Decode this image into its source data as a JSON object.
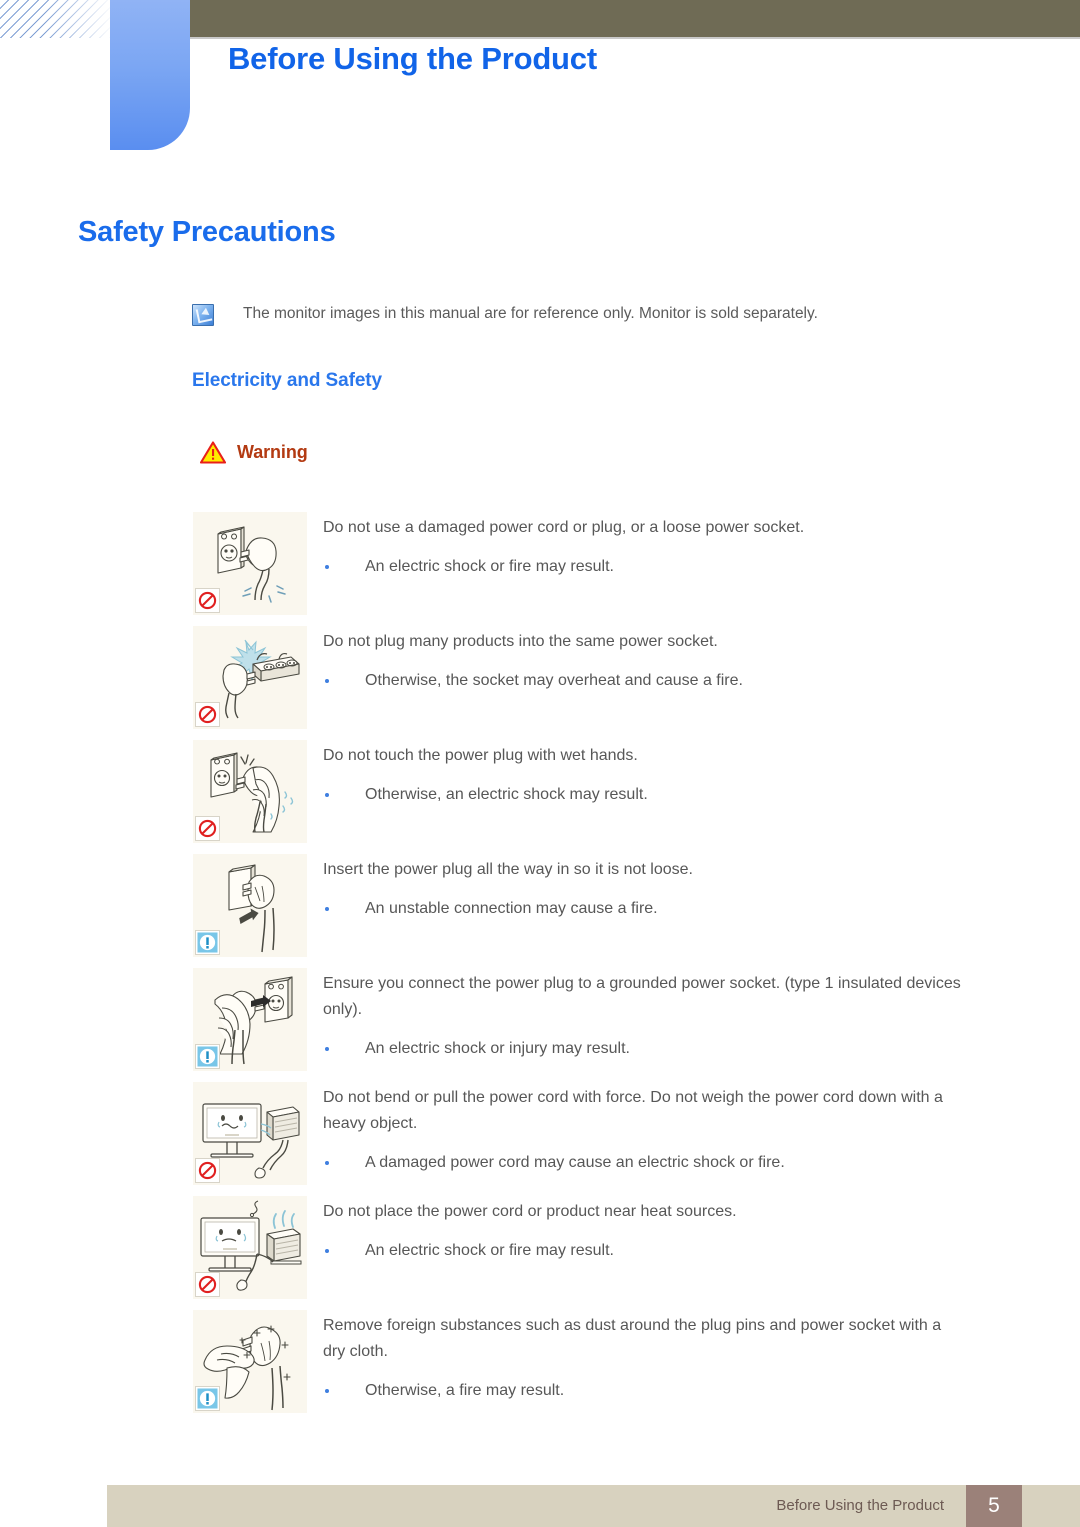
{
  "header": {
    "chapter_title": "Before Using the Product",
    "bar_color": "#6f6b55",
    "tab_color": "#7ba6f3",
    "title_color": "#1164e8"
  },
  "page_title": "Safety Precautions",
  "note": {
    "icon": "note-pen-icon",
    "text": "The monitor images in this manual are for reference only. Monitor is sold separately."
  },
  "section": {
    "heading": "Electricity and Safety",
    "warning_icon": "warning-triangle-icon",
    "warning_label": "Warning"
  },
  "items": [
    {
      "figure": "damaged-plug-socket-illustration",
      "badge": "prohibition-icon",
      "lead": "Do not use a damaged power cord or plug, or a loose power socket.",
      "bullets": [
        "An electric shock or fire may result."
      ]
    },
    {
      "figure": "overloaded-power-strip-illustration",
      "badge": "prohibition-icon",
      "lead": "Do not plug many products into the same power socket.",
      "bullets": [
        "Otherwise, the socket may overheat and cause a fire."
      ]
    },
    {
      "figure": "wet-hands-plug-illustration",
      "badge": "prohibition-icon",
      "lead": "Do not touch the power plug with wet hands.",
      "bullets": [
        "Otherwise, an electric shock may result."
      ]
    },
    {
      "figure": "insert-plug-fully-illustration",
      "badge": "mandatory-icon",
      "lead": "Insert the power plug all the way in so it is not loose.",
      "bullets": [
        "An unstable connection may cause a fire."
      ]
    },
    {
      "figure": "grounded-socket-illustration",
      "badge": "mandatory-icon",
      "lead": "Ensure you connect the power plug to a grounded power socket. (type 1 insulated devices only).",
      "bullets": [
        "An electric shock or injury may result."
      ]
    },
    {
      "figure": "bent-cord-heavy-object-illustration",
      "badge": "prohibition-icon",
      "lead": "Do not bend or pull the power cord with force. Do not weigh the power cord down with a heavy object.",
      "bullets": [
        "A damaged power cord may cause an electric shock or fire."
      ]
    },
    {
      "figure": "cord-near-heat-source-illustration",
      "badge": "prohibition-icon",
      "lead": "Do not place the power cord or product near heat sources.",
      "bullets": [
        "An electric shock or fire may result."
      ]
    },
    {
      "figure": "clean-plug-pins-illustration",
      "badge": "mandatory-icon",
      "lead": "Remove foreign substances such as dust around the plug pins and power socket with a dry cloth.",
      "bullets": [
        "Otherwise, a fire may result."
      ]
    }
  ],
  "footer": {
    "text": "Before Using the Product",
    "page_number": "5",
    "bar_color": "#d8d2bf",
    "page_box_color": "#9b8179"
  }
}
